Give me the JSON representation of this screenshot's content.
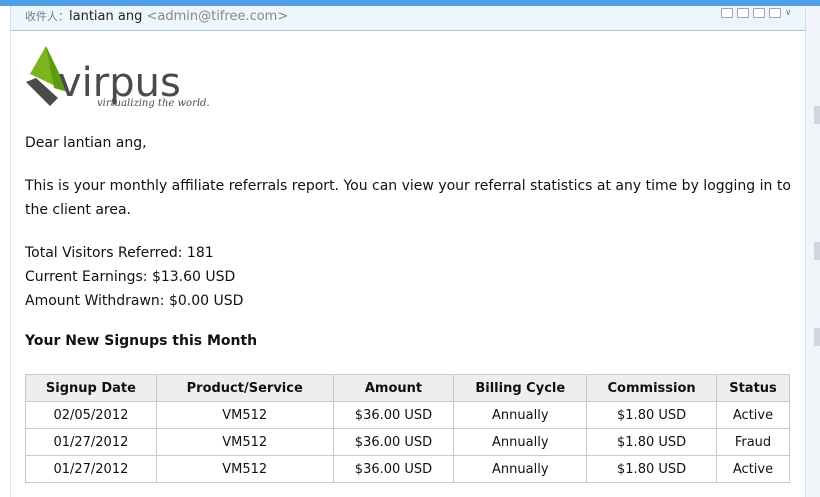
{
  "header": {
    "recipient_label": "收件人：",
    "recipient_name": "lantian ang",
    "recipient_email": "<admin@tifree.com>",
    "icons": [
      "window-icon",
      "page-icon",
      "print-icon",
      "new-window-icon",
      "chevron-down-icon"
    ]
  },
  "logo": {
    "brand": "virpus",
    "tagline": "virtualizing the world.",
    "colors": {
      "green": "#7ab51d",
      "dark": "#4a4a4a",
      "brand_text": "#b5332c"
    }
  },
  "email": {
    "greeting": "Dear lantian ang,",
    "intro": "This is your monthly affiliate referrals report. You can view your referral statistics at any time by logging in to the client area.",
    "stats": {
      "visitors": "Total Visitors Referred: 181",
      "earnings": "Current Earnings: $13.60 USD",
      "withdrawn": "Amount Withdrawn: $0.00 USD"
    },
    "signups_heading": "Your New Signups this Month",
    "table": {
      "columns": [
        "Signup Date",
        "Product/Service",
        "Amount",
        "Billing Cycle",
        "Commission",
        "Status"
      ],
      "rows": [
        [
          "02/05/2012",
          "VM512",
          "$36.00 USD",
          "Annually",
          "$1.80 USD",
          "Active"
        ],
        [
          "01/27/2012",
          "VM512",
          "$36.00 USD",
          "Annually",
          "$1.80 USD",
          "Fraud"
        ],
        [
          "01/27/2012",
          "VM512",
          "$36.00 USD",
          "Annually",
          "$1.80 USD",
          "Active"
        ]
      ]
    }
  },
  "colors": {
    "topbar": "#4f9ee6",
    "header_bg": "#eef6fd",
    "table_header_bg": "#eeeeee"
  }
}
